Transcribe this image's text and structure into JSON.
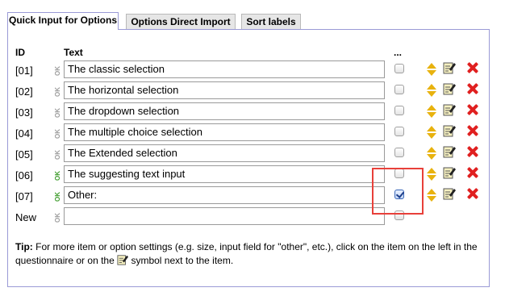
{
  "tabs": [
    {
      "label": "Quick Input for Options",
      "active": true
    },
    {
      "label": "Options Direct Import",
      "active": false
    },
    {
      "label": "Sort labels",
      "active": false
    }
  ],
  "headers": {
    "id": "ID",
    "text": "Text",
    "more": "..."
  },
  "ok_label": "OK",
  "rows": [
    {
      "id": "[01]",
      "text": "The classic selection",
      "ok_active": false,
      "checked": false
    },
    {
      "id": "[02]",
      "text": "The horizontal selection",
      "ok_active": false,
      "checked": false
    },
    {
      "id": "[03]",
      "text": "The dropdown selection",
      "ok_active": false,
      "checked": false
    },
    {
      "id": "[04]",
      "text": "The multiple choice selection",
      "ok_active": false,
      "checked": false
    },
    {
      "id": "[05]",
      "text": "The Extended selection",
      "ok_active": false,
      "checked": false
    },
    {
      "id": "[06]",
      "text": "The suggesting text input",
      "ok_active": true,
      "checked": false
    },
    {
      "id": "[07]",
      "text": "Other:",
      "ok_active": true,
      "checked": true
    }
  ],
  "new_row": {
    "id": "New",
    "text": "",
    "checked": false
  },
  "tip": {
    "label": "Tip:",
    "text_before": "For more item or option settings (e.g. size, input field for \"other\", etc.), click on the item on the left in the questionnaire or on the",
    "text_after": "symbol next to the item."
  },
  "icons": {
    "updown": "up-down-arrows-icon",
    "edit": "edit-pencil-icon",
    "delete": "delete-x-icon"
  },
  "colors": {
    "accent_border": "#9a9ad6",
    "ok_green": "#3a9a28",
    "delete_red": "#e02020",
    "highlight": "#e8403a",
    "arrow_yellow": "#e8b20e"
  }
}
